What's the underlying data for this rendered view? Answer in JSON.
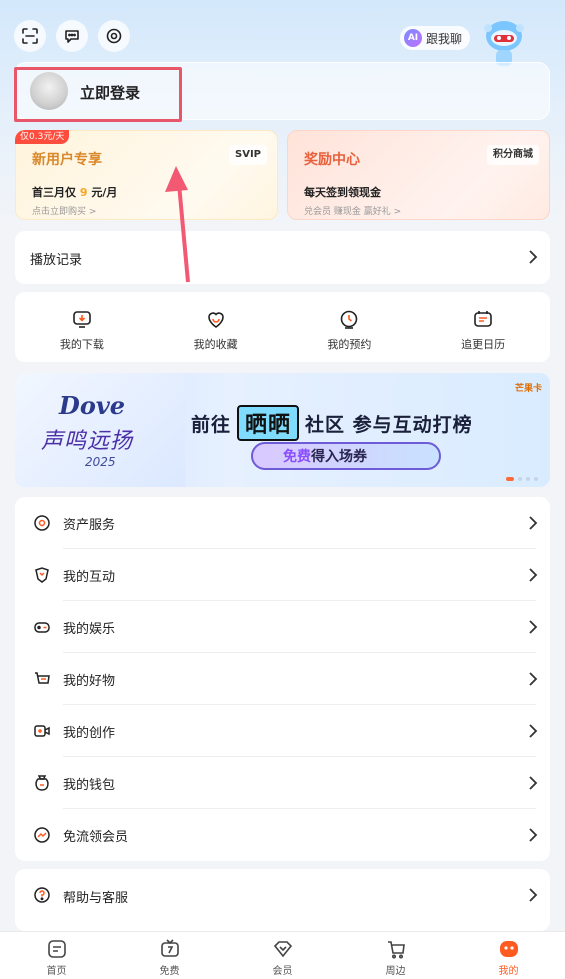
{
  "header": {
    "ai_chat_label": "跟我聊",
    "ai_badge": "AI"
  },
  "login": {
    "label": "立即登录"
  },
  "promos": {
    "new_user": {
      "tag": "仅0.3元/天",
      "title": "新用户专享",
      "chip": "SVIP",
      "line_prefix": "首三月仅",
      "line_num": "9",
      "line_suffix": "元/月",
      "sub": "点击立即购买 >"
    },
    "rewards": {
      "title": "奖励中心",
      "chip": "积分商城",
      "line": "每天签到领现金",
      "sub": "兑会员 赚现金 赢好礼 >"
    }
  },
  "history": {
    "label": "播放记录"
  },
  "quick_links": [
    {
      "label": "我的下载",
      "icon": "download-icon"
    },
    {
      "label": "我的收藏",
      "icon": "favorite-icon"
    },
    {
      "label": "我的预约",
      "icon": "reservation-icon"
    },
    {
      "label": "追更日历",
      "icon": "calendar-icon"
    }
  ],
  "banner": {
    "brand": "Dove",
    "brand_sub": "声鸣远扬",
    "year": "2025",
    "headline_a": "前往",
    "headline_b": "晒晒",
    "headline_c": "社区 参与互动打榜",
    "button_free": "免费",
    "button_rest": "得入场券",
    "logos": "芒果卡"
  },
  "menu": [
    {
      "label": "资产服务",
      "icon": "asset-icon"
    },
    {
      "label": "我的互动",
      "icon": "interaction-icon"
    },
    {
      "label": "我的娱乐",
      "icon": "entertainment-icon"
    },
    {
      "label": "我的好物",
      "icon": "goods-icon"
    },
    {
      "label": "我的创作",
      "icon": "creation-icon"
    },
    {
      "label": "我的钱包",
      "icon": "wallet-icon"
    },
    {
      "label": "免流领会员",
      "icon": "free-data-icon"
    }
  ],
  "help": {
    "label": "帮助与客服"
  },
  "tabs": [
    {
      "label": "首页"
    },
    {
      "label": "免费"
    },
    {
      "label": "会员"
    },
    {
      "label": "周边"
    },
    {
      "label": "我的"
    }
  ],
  "colors": {
    "accent": "#ff5a1f",
    "highlight_box": "#e8566a",
    "arrow": "#f25a73"
  }
}
